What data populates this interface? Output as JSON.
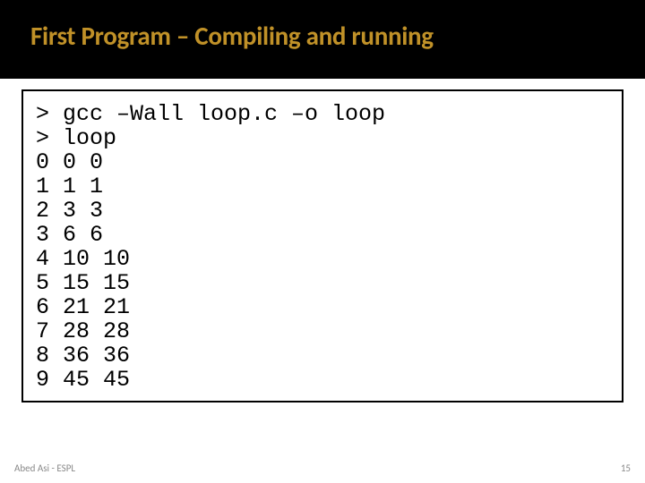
{
  "title": "First Program – Compiling and running",
  "code": {
    "lines": [
      "> gcc –Wall loop.c –o loop",
      "> loop",
      "0 0 0",
      "1 1 1",
      "2 3 3",
      "3 6 6",
      "4 10 10",
      "5 15 15",
      "6 21 21",
      "7 28 28",
      "8 36 36",
      "9 45 45"
    ]
  },
  "footer": {
    "left": "Abed Asi - ESPL",
    "right": "15"
  }
}
